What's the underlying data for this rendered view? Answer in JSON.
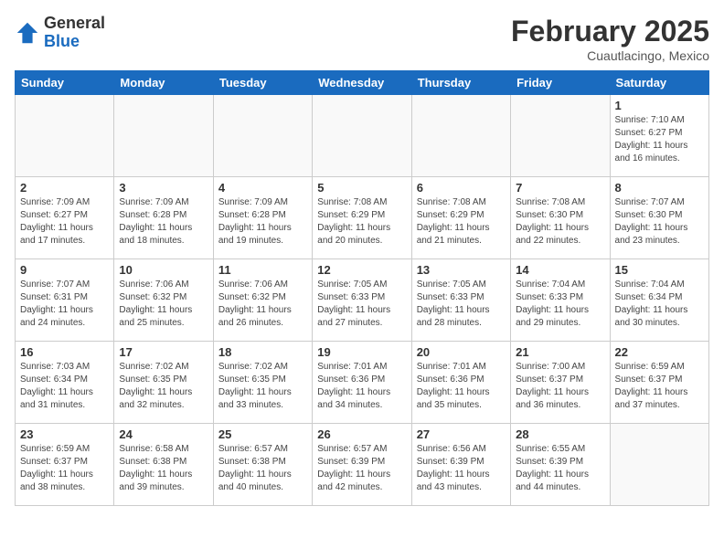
{
  "logo": {
    "general": "General",
    "blue": "Blue"
  },
  "header": {
    "month": "February 2025",
    "location": "Cuautlacingo, Mexico"
  },
  "weekdays": [
    "Sunday",
    "Monday",
    "Tuesday",
    "Wednesday",
    "Thursday",
    "Friday",
    "Saturday"
  ],
  "weeks": [
    [
      {
        "day": null
      },
      {
        "day": null
      },
      {
        "day": null
      },
      {
        "day": null
      },
      {
        "day": null
      },
      {
        "day": null
      },
      {
        "day": 1,
        "sunrise": "7:10 AM",
        "sunset": "6:27 PM",
        "daylight": "11 hours and 16 minutes."
      }
    ],
    [
      {
        "day": 2,
        "sunrise": "7:09 AM",
        "sunset": "6:27 PM",
        "daylight": "11 hours and 17 minutes."
      },
      {
        "day": 3,
        "sunrise": "7:09 AM",
        "sunset": "6:28 PM",
        "daylight": "11 hours and 18 minutes."
      },
      {
        "day": 4,
        "sunrise": "7:09 AM",
        "sunset": "6:28 PM",
        "daylight": "11 hours and 19 minutes."
      },
      {
        "day": 5,
        "sunrise": "7:08 AM",
        "sunset": "6:29 PM",
        "daylight": "11 hours and 20 minutes."
      },
      {
        "day": 6,
        "sunrise": "7:08 AM",
        "sunset": "6:29 PM",
        "daylight": "11 hours and 21 minutes."
      },
      {
        "day": 7,
        "sunrise": "7:08 AM",
        "sunset": "6:30 PM",
        "daylight": "11 hours and 22 minutes."
      },
      {
        "day": 8,
        "sunrise": "7:07 AM",
        "sunset": "6:30 PM",
        "daylight": "11 hours and 23 minutes."
      }
    ],
    [
      {
        "day": 9,
        "sunrise": "7:07 AM",
        "sunset": "6:31 PM",
        "daylight": "11 hours and 24 minutes."
      },
      {
        "day": 10,
        "sunrise": "7:06 AM",
        "sunset": "6:32 PM",
        "daylight": "11 hours and 25 minutes."
      },
      {
        "day": 11,
        "sunrise": "7:06 AM",
        "sunset": "6:32 PM",
        "daylight": "11 hours and 26 minutes."
      },
      {
        "day": 12,
        "sunrise": "7:05 AM",
        "sunset": "6:33 PM",
        "daylight": "11 hours and 27 minutes."
      },
      {
        "day": 13,
        "sunrise": "7:05 AM",
        "sunset": "6:33 PM",
        "daylight": "11 hours and 28 minutes."
      },
      {
        "day": 14,
        "sunrise": "7:04 AM",
        "sunset": "6:33 PM",
        "daylight": "11 hours and 29 minutes."
      },
      {
        "day": 15,
        "sunrise": "7:04 AM",
        "sunset": "6:34 PM",
        "daylight": "11 hours and 30 minutes."
      }
    ],
    [
      {
        "day": 16,
        "sunrise": "7:03 AM",
        "sunset": "6:34 PM",
        "daylight": "11 hours and 31 minutes."
      },
      {
        "day": 17,
        "sunrise": "7:02 AM",
        "sunset": "6:35 PM",
        "daylight": "11 hours and 32 minutes."
      },
      {
        "day": 18,
        "sunrise": "7:02 AM",
        "sunset": "6:35 PM",
        "daylight": "11 hours and 33 minutes."
      },
      {
        "day": 19,
        "sunrise": "7:01 AM",
        "sunset": "6:36 PM",
        "daylight": "11 hours and 34 minutes."
      },
      {
        "day": 20,
        "sunrise": "7:01 AM",
        "sunset": "6:36 PM",
        "daylight": "11 hours and 35 minutes."
      },
      {
        "day": 21,
        "sunrise": "7:00 AM",
        "sunset": "6:37 PM",
        "daylight": "11 hours and 36 minutes."
      },
      {
        "day": 22,
        "sunrise": "6:59 AM",
        "sunset": "6:37 PM",
        "daylight": "11 hours and 37 minutes."
      }
    ],
    [
      {
        "day": 23,
        "sunrise": "6:59 AM",
        "sunset": "6:37 PM",
        "daylight": "11 hours and 38 minutes."
      },
      {
        "day": 24,
        "sunrise": "6:58 AM",
        "sunset": "6:38 PM",
        "daylight": "11 hours and 39 minutes."
      },
      {
        "day": 25,
        "sunrise": "6:57 AM",
        "sunset": "6:38 PM",
        "daylight": "11 hours and 40 minutes."
      },
      {
        "day": 26,
        "sunrise": "6:57 AM",
        "sunset": "6:39 PM",
        "daylight": "11 hours and 42 minutes."
      },
      {
        "day": 27,
        "sunrise": "6:56 AM",
        "sunset": "6:39 PM",
        "daylight": "11 hours and 43 minutes."
      },
      {
        "day": 28,
        "sunrise": "6:55 AM",
        "sunset": "6:39 PM",
        "daylight": "11 hours and 44 minutes."
      },
      {
        "day": null
      }
    ]
  ]
}
